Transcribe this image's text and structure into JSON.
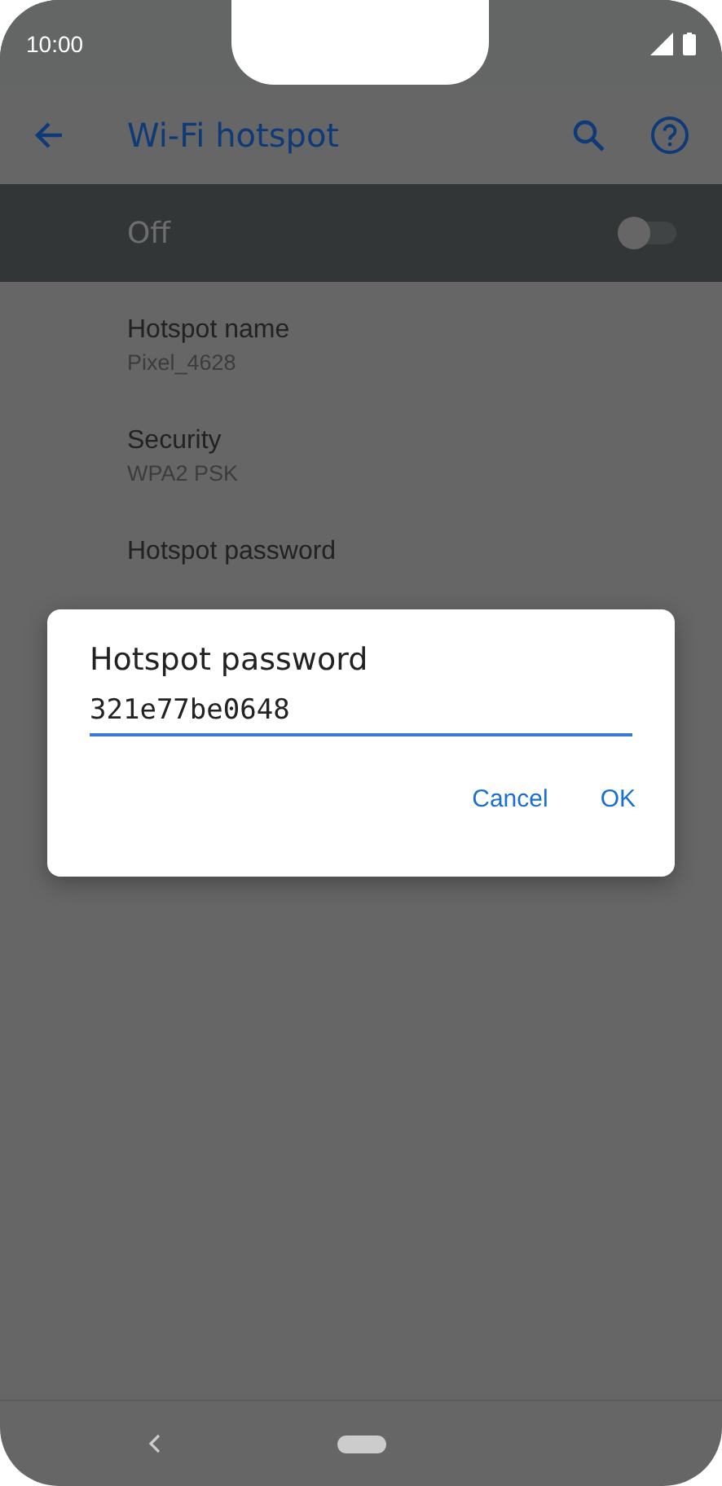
{
  "status_bar": {
    "time": "10:00"
  },
  "toolbar": {
    "title": "Wi-Fi hotspot"
  },
  "master_switch": {
    "label": "Off",
    "on": false
  },
  "settings": [
    {
      "title": "Hotspot name",
      "summary": "Pixel_4628"
    },
    {
      "title": "Security",
      "summary": "WPA2 PSK"
    },
    {
      "title": "Hotspot password"
    }
  ],
  "dialog": {
    "title": "Hotspot password",
    "value": "321e77be0648",
    "buttons": [
      "Cancel",
      "OK"
    ]
  }
}
